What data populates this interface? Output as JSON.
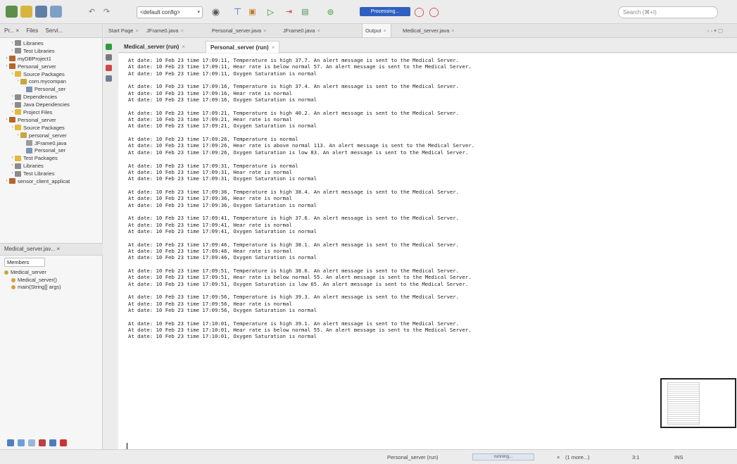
{
  "toolbar": {
    "config_value": "<default config>",
    "progress_badge": "Processing...",
    "search_placeholder": "Search (⌘+I)"
  },
  "projects_panel": {
    "tabs": [
      "Pr... ×",
      "Files",
      "Servi..."
    ],
    "tree": [
      {
        "label": "Libraries",
        "icon": "library-icon",
        "indent": 1
      },
      {
        "label": "Test Libraries",
        "icon": "library-icon",
        "indent": 1
      },
      {
        "label": "myDBProject1",
        "icon": "project-icon",
        "indent": 0
      },
      {
        "label": "Personal_server",
        "icon": "project-icon",
        "indent": 0
      },
      {
        "label": "Source Packages",
        "icon": "folder-icon",
        "indent": 1
      },
      {
        "label": "com.mycompan",
        "icon": "package-icon",
        "indent": 2
      },
      {
        "label": "Personal_ser",
        "icon": "java-file-icon",
        "indent": 3
      },
      {
        "label": "Dependencies",
        "icon": "library-icon",
        "indent": 1
      },
      {
        "label": "Java Dependencies",
        "icon": "library-icon",
        "indent": 1
      },
      {
        "label": "Project Files",
        "icon": "folder-icon",
        "indent": 1
      },
      {
        "label": "Personal_server",
        "icon": "project-icon",
        "indent": 0
      },
      {
        "label": "Source Packages",
        "icon": "folder-icon",
        "indent": 1
      },
      {
        "label": "personal_server",
        "icon": "package-icon",
        "indent": 2
      },
      {
        "label": "JFrame0.java",
        "icon": "form-file-icon",
        "indent": 3
      },
      {
        "label": "Personal_ser",
        "icon": "java-file-icon",
        "indent": 3
      },
      {
        "label": "Test Packages",
        "icon": "folder-icon",
        "indent": 1
      },
      {
        "label": "Libraries",
        "icon": "library-icon",
        "indent": 1
      },
      {
        "label": "Test Libraries",
        "icon": "library-icon",
        "indent": 1
      },
      {
        "label": "sensor_client_applicat",
        "icon": "project-icon",
        "indent": 0
      }
    ]
  },
  "navigator": {
    "title": "Medical_server.jav... ×",
    "members_select": "Members",
    "items": [
      {
        "label": "Medical_server",
        "indent": 0
      },
      {
        "label": "Medical_server()",
        "indent": 1
      },
      {
        "label": "main(String[] args)",
        "indent": 1
      }
    ]
  },
  "editor_tabs": [
    {
      "label": "Start Page",
      "active": false
    },
    {
      "label": "JFrame0.java",
      "active": false
    },
    {
      "label": "Personal_server.java",
      "active": false
    },
    {
      "label": "JFrame0.java",
      "active": false
    },
    {
      "label": "Output",
      "active": true
    },
    {
      "label": "Medical_server.java",
      "active": false
    }
  ],
  "output_tabs": [
    {
      "label": "Medical_server (run)",
      "active": false
    },
    {
      "label": "Personal_server (run)",
      "active": true
    }
  ],
  "console_lines": [
    "At date: 10 Feb 23 time 17:09:11, Temperature is high 37.7. An alert message is sent to the Medical Server.",
    "At date: 10 Feb 23 time 17:09:11, Hear rate is below normal 57. An alert message is sent to the Medical Server.",
    "At date: 10 Feb 23 time 17:09:11, Oxygen Saturation is normal",
    "",
    "At date: 10 Feb 23 time 17:09:16, Temperature is high 37.4. An alert message is sent to the Medical Server.",
    "At date: 10 Feb 23 time 17:09:16, Hear rate is normal",
    "At date: 10 Feb 23 time 17:09:16, Oxygen Saturation is normal",
    "",
    "At date: 10 Feb 23 time 17:09:21, Temperature is high 40.2. An alert message is sent to the Medical Server.",
    "At date: 10 Feb 23 time 17:09:21, Hear rate is normal",
    "At date: 10 Feb 23 time 17:09:21, Oxygen Saturation is normal",
    "",
    "At date: 10 Feb 23 time 17:09:26, Temperature is normal",
    "At date: 10 Feb 23 time 17:09:26, Hear rate is above normal 113. An alert message is sent to the Medical Server.",
    "At date: 10 Feb 23 time 17:09:26, Oxygen Saturation is low 83. An alert message is sent to the Medical Server.",
    "",
    "At date: 10 Feb 23 time 17:09:31, Temperature is normal",
    "At date: 10 Feb 23 time 17:09:31, Hear rate is normal",
    "At date: 10 Feb 23 time 17:09:31, Oxygen Saturation is normal",
    "",
    "At date: 10 Feb 23 time 17:09:36, Temperature is high 38.4. An alert message is sent to the Medical Server.",
    "At date: 10 Feb 23 time 17:09:36, Hear rate is normal",
    "At date: 10 Feb 23 time 17:09:36, Oxygen Saturation is normal",
    "",
    "At date: 10 Feb 23 time 17:09:41, Temperature is high 37.6. An alert message is sent to the Medical Server.",
    "At date: 10 Feb 23 time 17:09:41, Hear rate is normal",
    "At date: 10 Feb 23 time 17:09:41, Oxygen Saturation is normal",
    "",
    "At date: 10 Feb 23 time 17:09:46, Temperature is high 38.1. An alert message is sent to the Medical Server.",
    "At date: 10 Feb 23 time 17:09:46, Hear rate is normal",
    "At date: 10 Feb 23 time 17:09:46, Oxygen Saturation is normal",
    "",
    "At date: 10 Feb 23 time 17:09:51, Temperature is high 38.6. An alert message is sent to the Medical Server.",
    "At date: 10 Feb 23 time 17:09:51, Hear rate is below normal 55. An alert message is sent to the Medical Server.",
    "At date: 10 Feb 23 time 17:09:51, Oxygen Saturation is low 65. An alert message is sent to the Medical Server.",
    "",
    "At date: 10 Feb 23 time 17:09:56, Temperature is high 39.3. An alert message is sent to the Medical Server.",
    "At date: 10 Feb 23 time 17:09:56, Hear rate is normal",
    "At date: 10 Feb 23 time 17:09:56, Oxygen Saturation is normal",
    "",
    "At date: 10 Feb 23 time 17:10:01, Temperature is high 39.1. An alert message is sent to the Medical Server.",
    "At date: 10 Feb 23 time 17:10:01, Hear rate is below normal 55. An alert message is sent to the Medical Server.",
    "At date: 10 Feb 23 time 17:10:01, Oxygen Saturation is normal"
  ],
  "statusbar": {
    "run_label": "Personal_server (run)",
    "progress_text": "running...",
    "more_label": "(1 more...)",
    "position": "3:1",
    "insert_mode": "INS"
  }
}
